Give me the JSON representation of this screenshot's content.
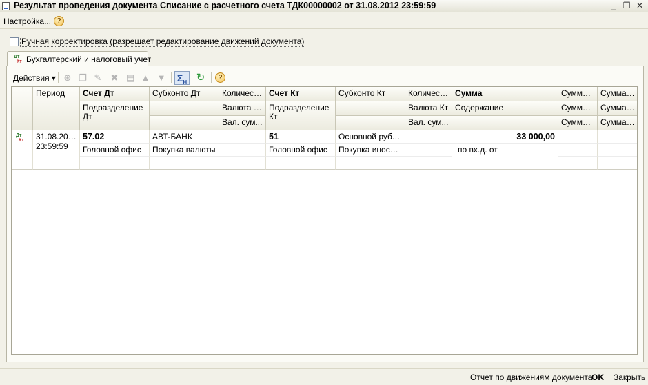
{
  "window": {
    "title": "Результат проведения документа Списание с расчетного счета ТДК00000002 от 31.08.2012 23:59:59"
  },
  "menu": {
    "settings_label": "Настройка...",
    "help_icon_text": "?"
  },
  "manual_correction": {
    "checked": false,
    "label": "Ручная корректировка (разрешает редактирование движений документа)"
  },
  "tabs": [
    {
      "label": "Бухгалтерский и налоговый учет",
      "icon_top": "Дт",
      "icon_bottom": "Кт"
    }
  ],
  "toolbar": {
    "actions_label": "Действия",
    "sigma_text": "Σ",
    "sigma_sub": "Н",
    "help_icon_text": "?"
  },
  "table": {
    "headers": {
      "period": "Период",
      "account_dt": "Счет Дт",
      "subconto_dt": "Субконто Дт",
      "qty_dt": "Количест...",
      "account_kt": "Счет Кт",
      "subconto_kt": "Субконто Кт",
      "qty_kt": "Количест...",
      "sum": "Сумма",
      "sum_a1": "Сумма ...",
      "sum_b1": "Сумма ...",
      "division_dt": "Подразделение Дт",
      "currency_dt": "Валюта Дт",
      "division_kt": "Подразделение Кт",
      "currency_kt": "Валюта Кт",
      "content": "Содержание",
      "sum_a2": "Сумма ...",
      "sum_b2": "Сумма ...",
      "cur_sum_dt": "Вал. сум...",
      "cur_sum_kt": "Вал. сум...",
      "sum_a3": "Сумма ...",
      "sum_b3": "Сумма ..."
    },
    "rows": [
      {
        "icon_top": "Дт",
        "icon_bottom": "Кт",
        "period": "31.08.2012 23:59:59",
        "account_dt": "57.02",
        "subconto_dt": "АВТ-БАНК",
        "account_kt": "51",
        "subconto_kt": "Основной рубле...",
        "sum": "33 000,00",
        "division_dt": "Головной офис",
        "subconto_dt2": "Покупка валюты",
        "division_kt": "Головной офис",
        "subconto_kt2": "Покупка иностр...",
        "content": "по вх.д. от"
      }
    ]
  },
  "statusbar": {
    "report_label": "Отчет по движениям документа",
    "ok_label": "OK",
    "close_label": "Закрыть"
  }
}
